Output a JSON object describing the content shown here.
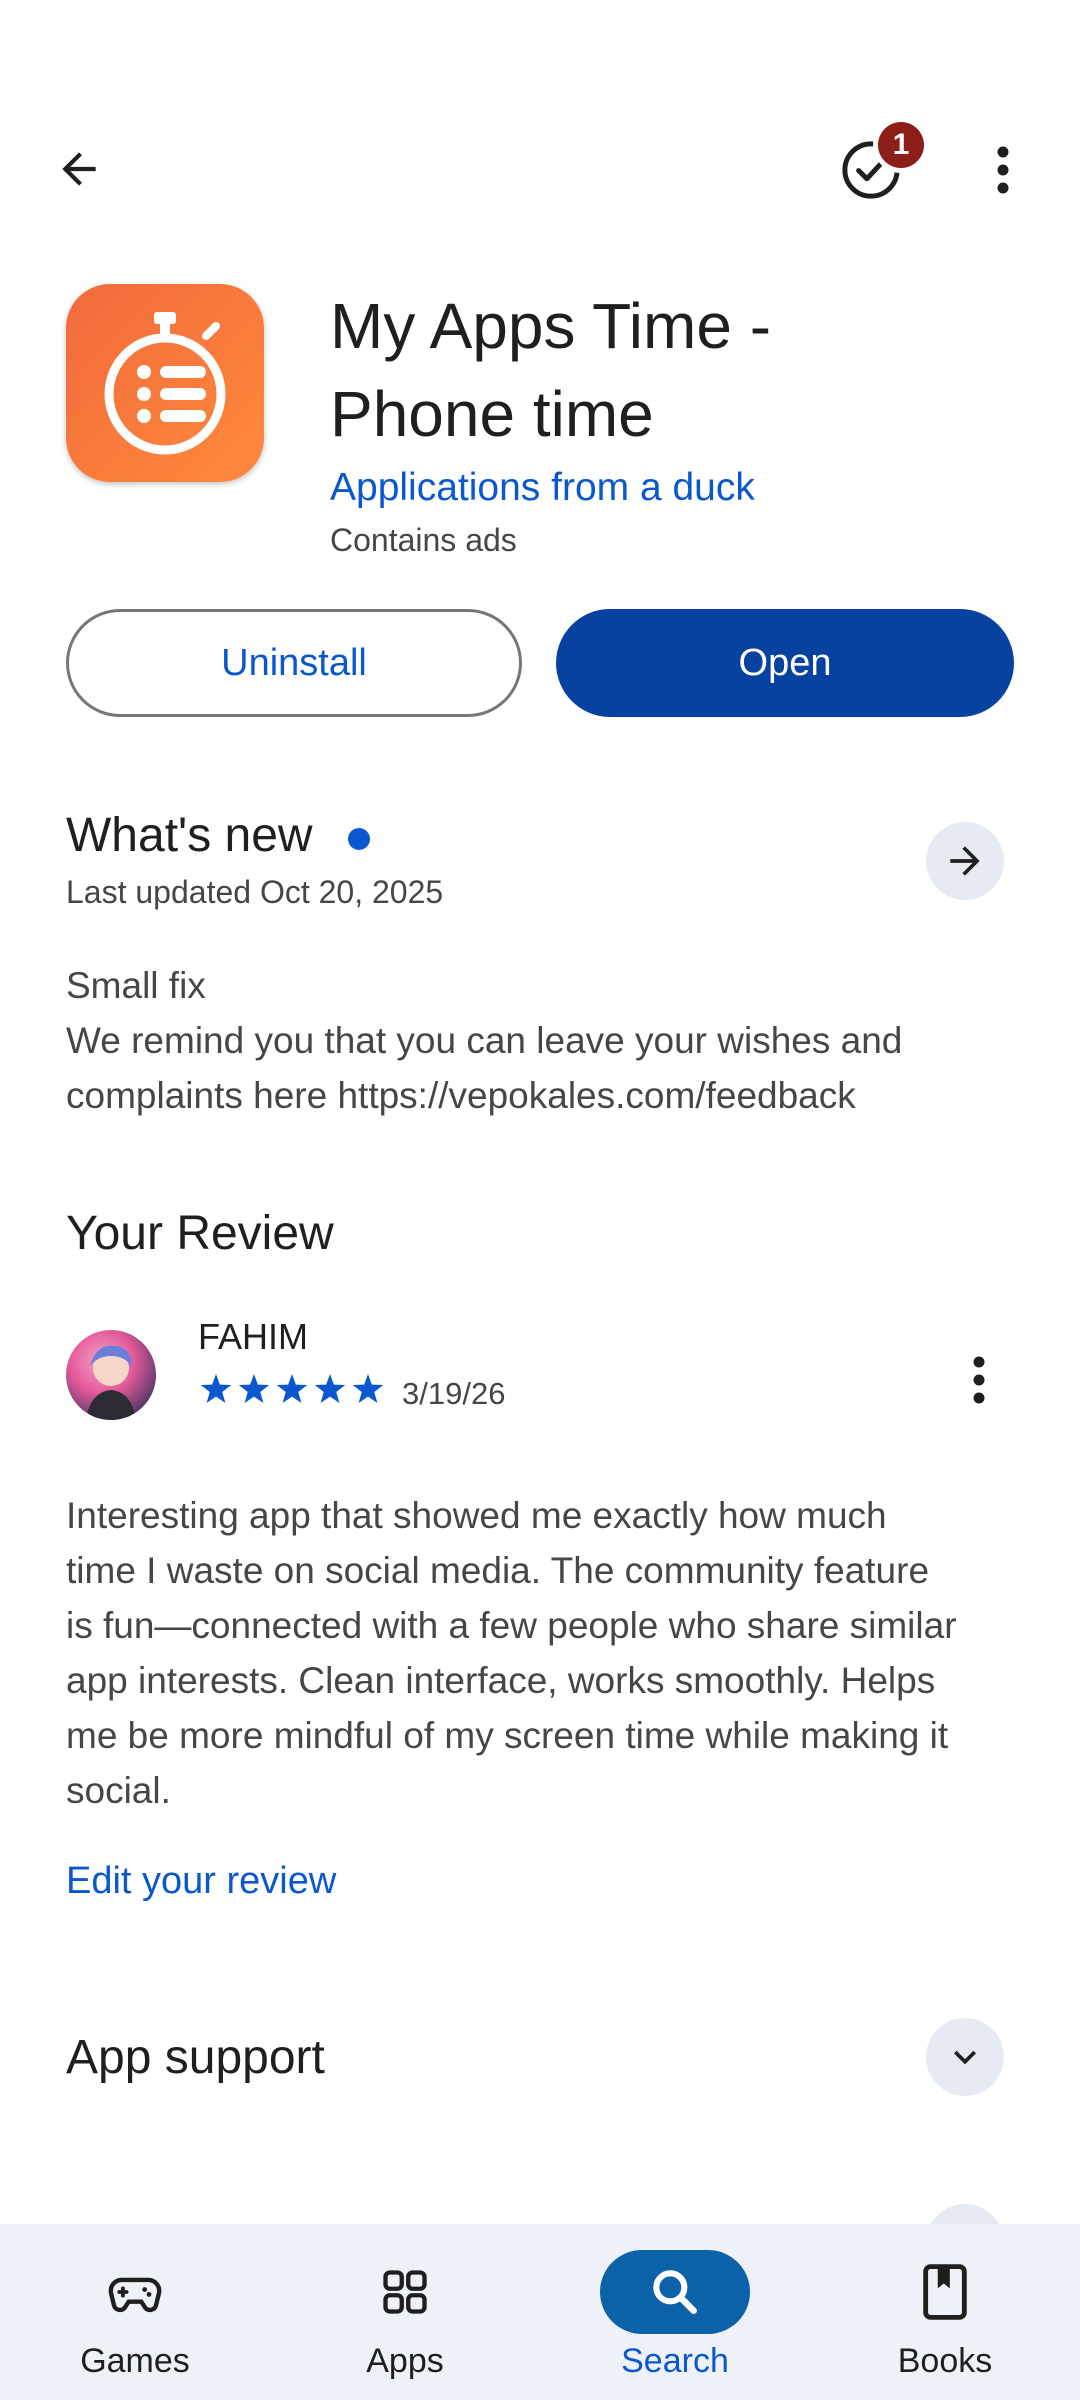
{
  "top_bar": {
    "back_icon": "arrow-back-icon",
    "tasks_icon": "check-circle-icon",
    "notification_count": "1",
    "more_icon": "more-vert-icon"
  },
  "app": {
    "title_line1": "My Apps Time -",
    "title_line2": "Phone time",
    "developer": "Applications from a duck",
    "ads_notice": "Contains ads",
    "icon": "stopwatch-list-icon",
    "icon_color": "#f4743b"
  },
  "actions": {
    "uninstall_label": "Uninstall",
    "open_label": "Open"
  },
  "whats_new": {
    "title": "What's new",
    "updated": "Last updated Oct 20, 2025",
    "line1": "Small fix",
    "line2": "We remind you that you can leave your wishes and",
    "line3": "complaints here https://vepokales.com/feedback"
  },
  "review": {
    "section_title": "Your Review",
    "author": "FAHIM",
    "rating": 5,
    "rating_max": 5,
    "date": "3/19/26",
    "text_lines": [
      "Interesting app that showed me exactly how much",
      "time I waste on social media. The community feature",
      "is fun—connected with a few people who share similar",
      "app interests. Clean interface, works smoothly. Helps",
      "me be more mindful of my screen time while making it",
      "social."
    ],
    "edit_label": "Edit your review"
  },
  "support": {
    "title": "App support"
  },
  "bottom_nav": {
    "items": [
      {
        "label": "Games",
        "icon": "gamepad-icon"
      },
      {
        "label": "Apps",
        "icon": "apps-grid-icon"
      },
      {
        "label": "Search",
        "icon": "search-icon"
      },
      {
        "label": "Books",
        "icon": "book-icon"
      }
    ],
    "active": "Search"
  },
  "colors": {
    "accent": "#0b57d0",
    "open_button": "#0842a0",
    "badge": "#8c1d18"
  }
}
